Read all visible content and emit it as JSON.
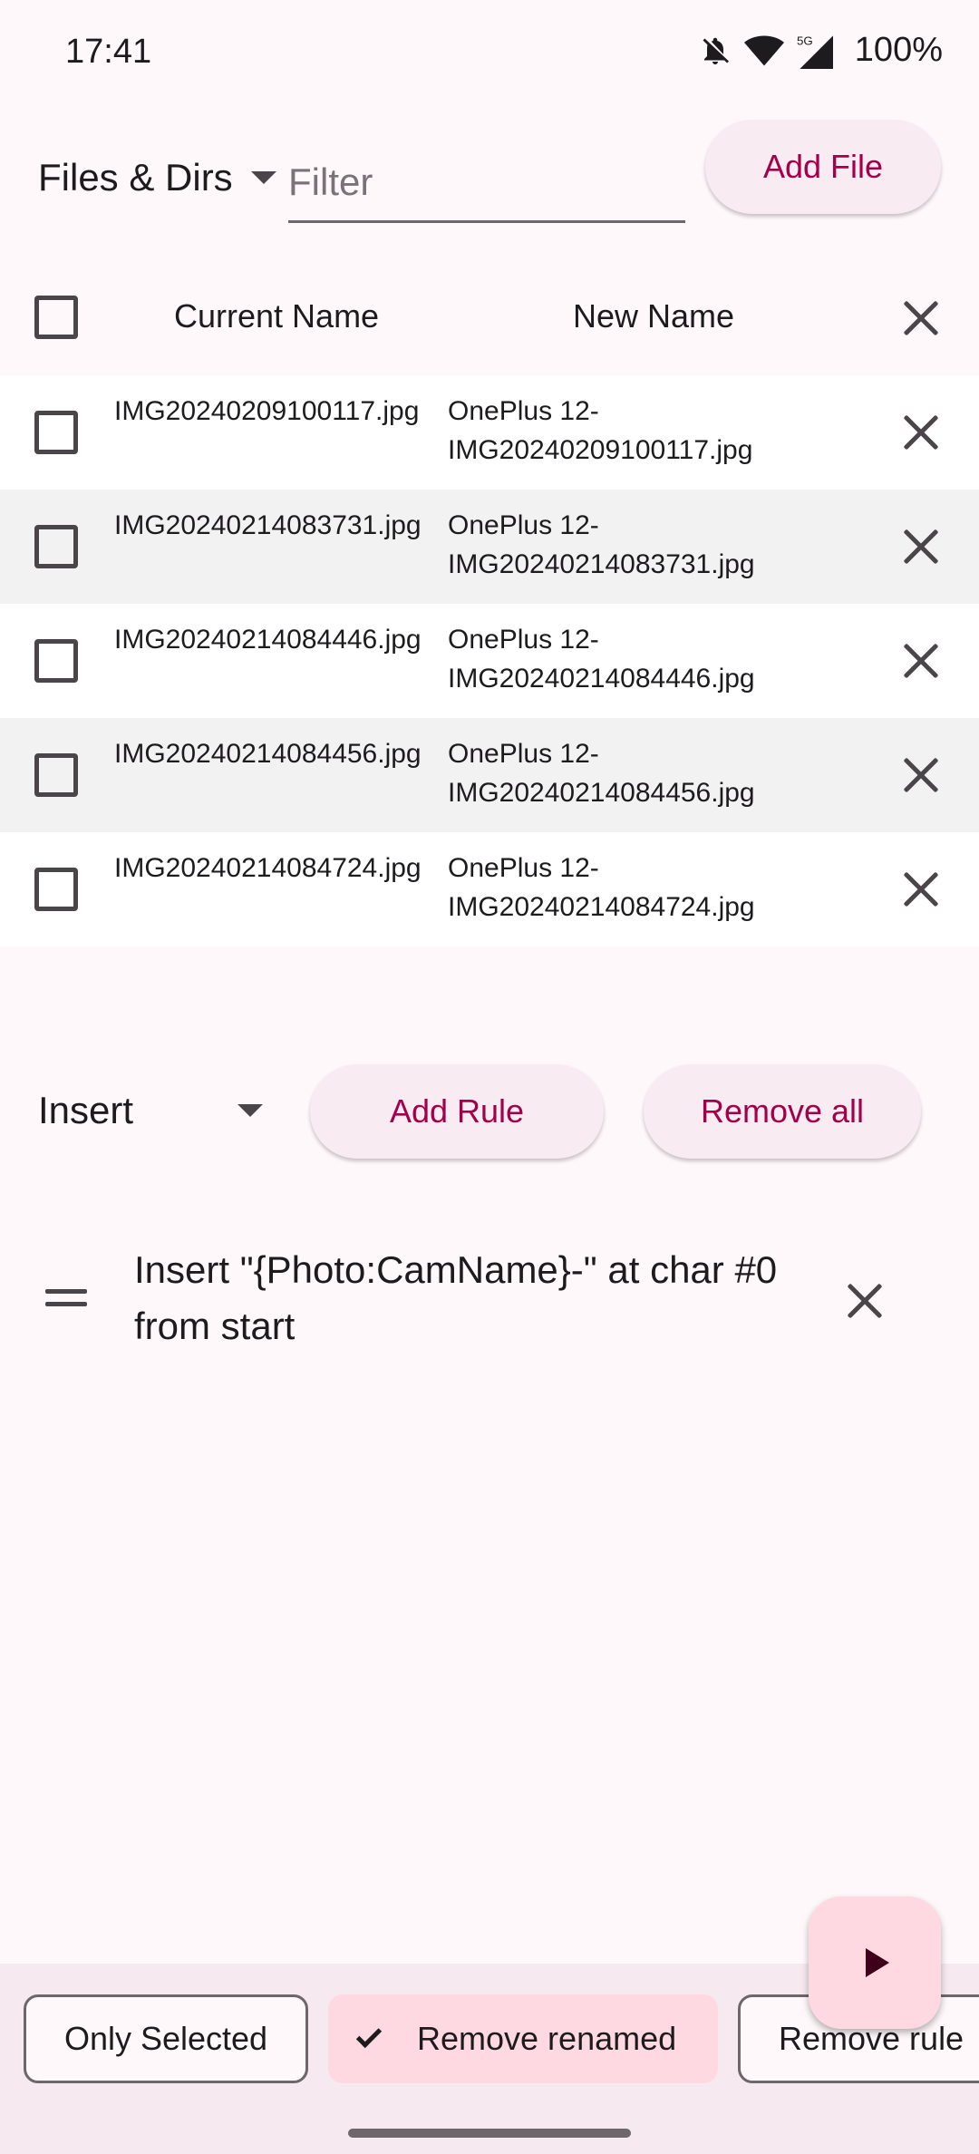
{
  "status_bar": {
    "time": "17:41",
    "battery": "100%",
    "icons": [
      "notifications-off-icon",
      "wifi-icon",
      "5g-signal-icon"
    ]
  },
  "toolbar": {
    "source_dropdown": "Files & Dirs",
    "filter_placeholder": "Filter",
    "add_file_label": "Add File"
  },
  "table": {
    "headers": {
      "current": "Current Name",
      "new": "New Name"
    },
    "rows": [
      {
        "current": "IMG20240209100117.jpg",
        "new": "OnePlus 12-IMG20240209100117.jpg"
      },
      {
        "current": "IMG20240214083731.jpg",
        "new": "OnePlus 12-IMG20240214083731.jpg"
      },
      {
        "current": "IMG20240214084446.jpg",
        "new": "OnePlus 12-IMG20240214084446.jpg"
      },
      {
        "current": "IMG20240214084456.jpg",
        "new": "OnePlus 12-IMG20240214084456.jpg"
      },
      {
        "current": "IMG20240214084724.jpg",
        "new": "OnePlus 12-IMG20240214084724.jpg"
      }
    ]
  },
  "rules": {
    "type_dropdown": "Insert",
    "add_rule_label": "Add Rule",
    "remove_all_label": "Remove all",
    "items": [
      {
        "text": "Insert \"{Photo:CamName}-\" at char #0 from start"
      }
    ]
  },
  "bottom_bar": {
    "chips": [
      {
        "label": "Only Selected",
        "selected": false
      },
      {
        "label": "Remove renamed",
        "selected": true
      },
      {
        "label": "Remove rule",
        "selected": false
      }
    ]
  },
  "colors": {
    "accent": "#a3004a",
    "background": "#fff8fb",
    "selected_chip": "#ffd9e2",
    "fab": "#ffd9e2"
  }
}
